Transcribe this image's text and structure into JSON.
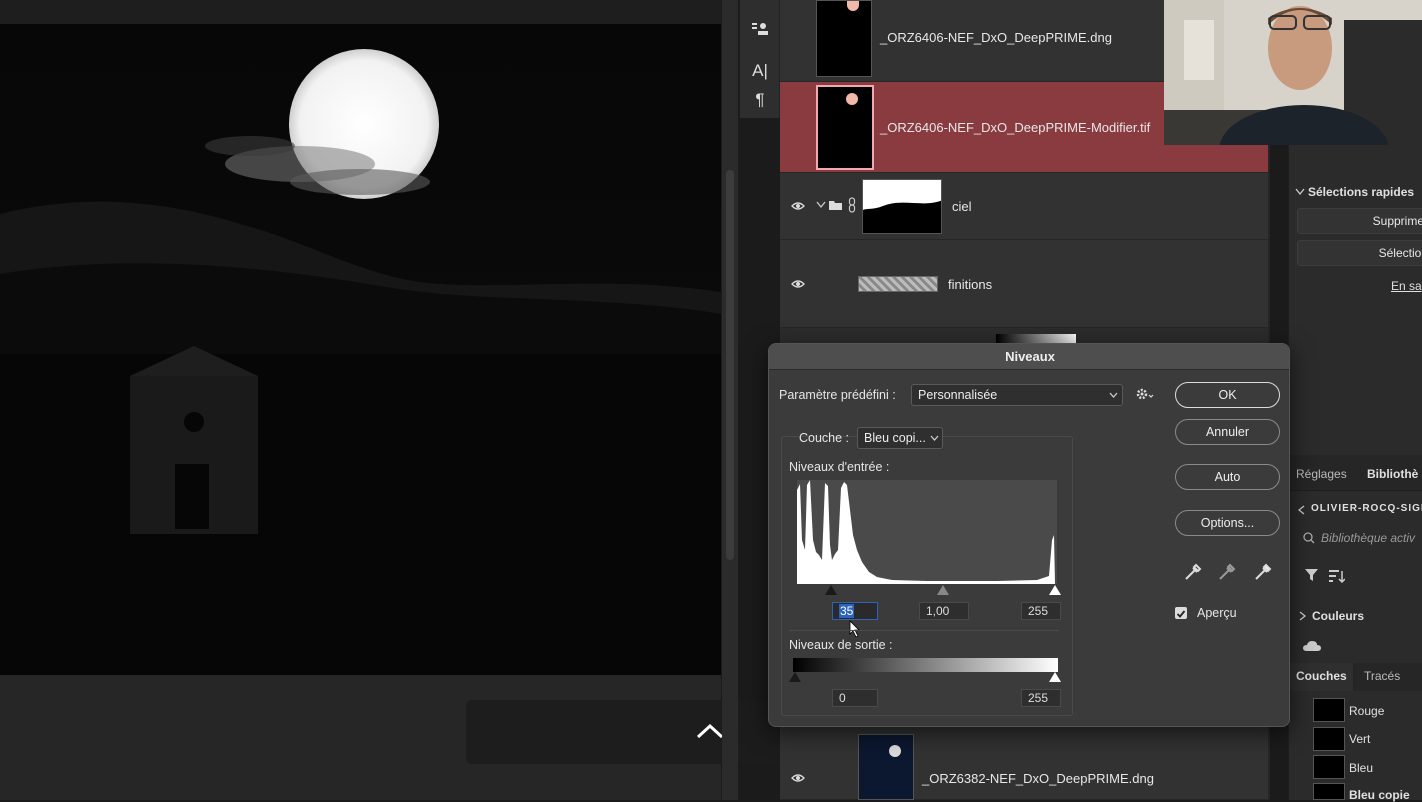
{
  "layers_panel": {
    "layers": [
      {
        "name": "_ORZ6406-NEF_DxO_DeepPRIME.dng"
      },
      {
        "name": "_ORZ6406-NEF_DxO_DeepPRIME-Modifier.tif"
      },
      {
        "name": "ciel"
      },
      {
        "name": "finitions"
      },
      {
        "name": "_ORZ6382-NEF_DxO_DeepPRIME.dng"
      }
    ]
  },
  "right_panel": {
    "quick_actions_title": "Sélections rapides",
    "btn_remove": "Supprimer",
    "btn_select": "Sélection",
    "link_more": "En sa",
    "tab_adjustments": "Réglages",
    "tab_libraries": "Bibliothè",
    "library_name": "OLIVIER-ROCQ-SIGN",
    "search_placeholder": "Bibliothèque activ",
    "section_colors": "Couleurs",
    "tab_channels": "Couches",
    "tab_paths": "Tracés",
    "channels": [
      "Rouge",
      "Vert",
      "Bleu",
      "Bleu copie"
    ]
  },
  "levels_dialog": {
    "title": "Niveaux",
    "preset_label": "Paramètre prédéfini :",
    "preset_value": "Personnalisée",
    "channel_label": "Couche :",
    "channel_value": "Bleu copi...",
    "input_levels_label": "Niveaux d'entrée :",
    "input_black": "35",
    "input_gamma": "1,00",
    "input_white": "255",
    "output_levels_label": "Niveaux de sortie :",
    "output_black": "0",
    "output_white": "255",
    "btn_ok": "OK",
    "btn_cancel": "Annuler",
    "btn_auto": "Auto",
    "btn_options": "Options...",
    "preview_label": "Aperçu",
    "preview_checked": true
  },
  "toolstrip": {
    "icons": [
      "brush-preset-icon",
      "character-icon",
      "paragraph-icon"
    ],
    "glyphs": [
      "A|",
      "¶"
    ]
  },
  "colors": {
    "selected_layer": "#8a3b3f",
    "panel_bg": "#323232",
    "highlight_field": "#2d63b8"
  }
}
